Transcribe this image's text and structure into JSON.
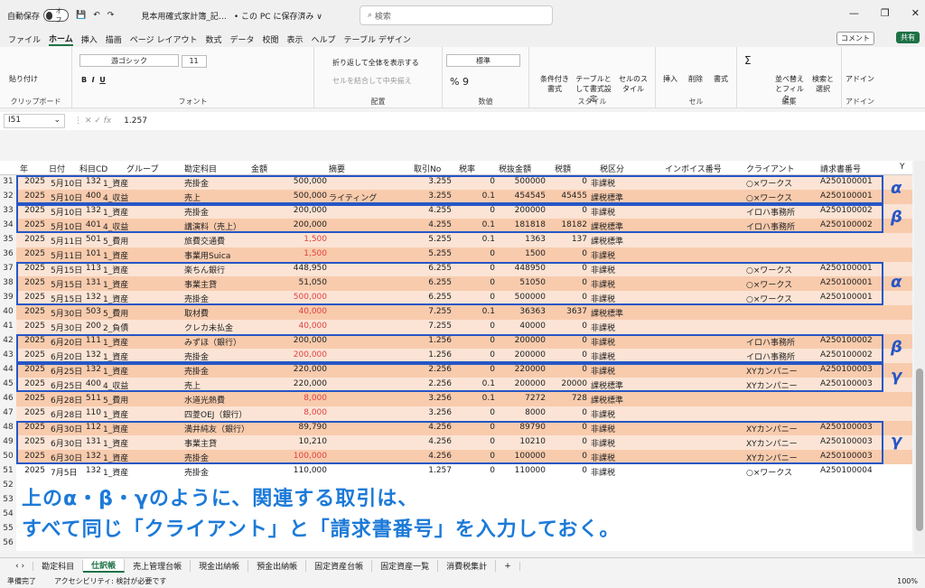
{
  "titlebar": {
    "autosave": "自動保存",
    "toggle": "オフ",
    "filename": "見本用確式家計簿_記…",
    "location": "• この PC に保存済み ∨",
    "search": "検索"
  },
  "menu": [
    "ファイル",
    "ホーム",
    "挿入",
    "描画",
    "ページ レイアウト",
    "数式",
    "データ",
    "校閲",
    "表示",
    "ヘルプ",
    "テーブル デザイン"
  ],
  "comment": "コメント",
  "share": "共有",
  "ribbon": {
    "paste": "貼り付け",
    "clipboard": "クリップボード",
    "font_name": "游ゴシック",
    "font_size": "11",
    "font": "フォント",
    "wrap": "折り返して全体を表示する",
    "merge": "セルを結合して中央揃え",
    "align": "配置",
    "numfmt": "標準",
    "number": "数値",
    "cond": "条件付き書式",
    "table": "テーブルとして書式設定",
    "cellstyle": "セルのスタイル",
    "style": "スタイル",
    "insert": "挿入",
    "delete": "削除",
    "format": "書式",
    "cells": "セル",
    "sort": "並べ替えとフィルター",
    "find": "検索と選択",
    "edit": "編集",
    "addin": "アドイン",
    "addins": "アドイン"
  },
  "formula": {
    "cell": "I51",
    "value": "1.257"
  },
  "headers": [
    "年",
    "日付",
    "科目CD",
    "グループ",
    "勘定科目",
    "金額",
    "摘要",
    "取引No",
    "税率",
    "税抜金額",
    "税額",
    "税区分",
    "インボイス番号",
    "クライアント",
    "請求書番号",
    "Y"
  ],
  "rows": [
    [
      "31",
      "2025",
      "5月10日",
      "132",
      "1_資産",
      "売掛金",
      "500,000",
      "",
      "3.255",
      "0",
      "500000",
      "0",
      "非課税",
      "",
      "○×ワークス",
      "A250100001"
    ],
    [
      "32",
      "2025",
      "5月10日",
      "400",
      "4_収益",
      "売上",
      "500,000",
      "ライティング",
      "3.255",
      "0.1",
      "454545",
      "45455",
      "課税標準",
      "",
      "○×ワークス",
      "A250100001"
    ],
    [
      "33",
      "2025",
      "5月10日",
      "132",
      "1_資産",
      "売掛金",
      "200,000",
      "",
      "4.255",
      "0",
      "200000",
      "0",
      "非課税",
      "",
      "イロハ事務所",
      "A250100002"
    ],
    [
      "34",
      "2025",
      "5月10日",
      "401",
      "4_収益",
      "講演料（売上）",
      "200,000",
      "",
      "4.255",
      "0.1",
      "181818",
      "18182",
      "課税標準",
      "",
      "イロハ事務所",
      "A250100002"
    ],
    [
      "35",
      "2025",
      "5月11日",
      "501",
      "5_費用",
      "旅費交通費",
      "1,500",
      "",
      "5.255",
      "0.1",
      "1363",
      "137",
      "課税標準",
      "",
      "",
      ""
    ],
    [
      "36",
      "2025",
      "5月11日",
      "101",
      "1_資産",
      "事業用Suica",
      "1,500",
      "",
      "5.255",
      "0",
      "1500",
      "0",
      "非課税",
      "",
      "",
      ""
    ],
    [
      "37",
      "2025",
      "5月15日",
      "113",
      "1_資産",
      "楽ちん銀行",
      "448,950",
      "",
      "6.255",
      "0",
      "448950",
      "0",
      "非課税",
      "",
      "○×ワークス",
      "A250100001"
    ],
    [
      "38",
      "2025",
      "5月15日",
      "131",
      "1_資産",
      "事業主貸",
      "51,050",
      "",
      "6.255",
      "0",
      "51050",
      "0",
      "非課税",
      "",
      "○×ワークス",
      "A250100001"
    ],
    [
      "39",
      "2025",
      "5月15日",
      "132",
      "1_資産",
      "売掛金",
      "500,000",
      "",
      "6.255",
      "0",
      "500000",
      "0",
      "非課税",
      "",
      "○×ワークス",
      "A250100001"
    ],
    [
      "40",
      "2025",
      "5月30日",
      "503",
      "5_費用",
      "取材費",
      "40,000",
      "",
      "7.255",
      "0.1",
      "36363",
      "3637",
      "課税標準",
      "",
      "",
      ""
    ],
    [
      "41",
      "2025",
      "5月30日",
      "200",
      "2_負債",
      "クレカ未払金",
      "40,000",
      "",
      "7.255",
      "0",
      "40000",
      "0",
      "非課税",
      "",
      "",
      ""
    ],
    [
      "42",
      "2025",
      "6月20日",
      "111",
      "1_資産",
      "みずほ（銀行）",
      "200,000",
      "",
      "1.256",
      "0",
      "200000",
      "0",
      "非課税",
      "",
      "イロハ事務所",
      "A250100002"
    ],
    [
      "43",
      "2025",
      "6月20日",
      "132",
      "1_資産",
      "売掛金",
      "200,000",
      "",
      "1.256",
      "0",
      "200000",
      "0",
      "非課税",
      "",
      "イロハ事務所",
      "A250100002"
    ],
    [
      "44",
      "2025",
      "6月25日",
      "132",
      "1_資産",
      "売掛金",
      "220,000",
      "",
      "2.256",
      "0",
      "220000",
      "0",
      "非課税",
      "",
      "XYカンパニー",
      "A250100003"
    ],
    [
      "45",
      "2025",
      "6月25日",
      "400",
      "4_収益",
      "売上",
      "220,000",
      "",
      "2.256",
      "0.1",
      "200000",
      "20000",
      "課税標準",
      "",
      "XYカンパニー",
      "A250100003"
    ],
    [
      "46",
      "2025",
      "6月28日",
      "511",
      "5_費用",
      "水道光熱費",
      "8,000",
      "",
      "3.256",
      "0.1",
      "7272",
      "728",
      "課税標準",
      "",
      "",
      ""
    ],
    [
      "47",
      "2025",
      "6月28日",
      "110",
      "1_資産",
      "四菱OEJ（銀行）",
      "8,000",
      "",
      "3.256",
      "0",
      "8000",
      "0",
      "非課税",
      "",
      "",
      ""
    ],
    [
      "48",
      "2025",
      "6月30日",
      "112",
      "1_資産",
      "満井純友（銀行）",
      "89,790",
      "",
      "4.256",
      "0",
      "89790",
      "0",
      "非課税",
      "",
      "XYカンパニー",
      "A250100003"
    ],
    [
      "49",
      "2025",
      "6月30日",
      "131",
      "1_資産",
      "事業主貸",
      "10,210",
      "",
      "4.256",
      "0",
      "10210",
      "0",
      "非課税",
      "",
      "XYカンパニー",
      "A250100003"
    ],
    [
      "50",
      "2025",
      "6月30日",
      "132",
      "1_資産",
      "売掛金",
      "100,000",
      "",
      "4.256",
      "0",
      "100000",
      "0",
      "非課税",
      "",
      "XYカンパニー",
      "A250100003"
    ],
    [
      "51",
      "2025",
      "7月5日",
      "132",
      "1_資産",
      "売掛金",
      "110,000",
      "",
      "1.257",
      "0",
      "110000",
      "0",
      "非課税",
      "",
      "○×ワークス",
      "A250100004"
    ]
  ],
  "extra_rows": [
    "52",
    "53",
    "54",
    "55",
    "56"
  ],
  "greek": [
    "α",
    "β",
    "α",
    "β",
    "γ",
    "γ"
  ],
  "caption_line1": "上のα・β・γのように、関連する取引は、",
  "caption_line2": "すべて同じ「クライアント」と「請求書番号」を入力しておく。",
  "sheets": [
    "勘定科目",
    "仕訳帳",
    "売上管理台帳",
    "現金出納帳",
    "預金出納帳",
    "固定資産台帳",
    "固定資産一覧",
    "消費税集計"
  ],
  "status": {
    "ready": "準備完了",
    "access": "アクセシビリティ: 検討が必要です",
    "zoom": "100%"
  },
  "colors": {
    "odd": "#fbe4d5",
    "even": "#f8cbad",
    "red": "#e04040",
    "box": "#2656c6",
    "caption": "#1c7ad8"
  }
}
